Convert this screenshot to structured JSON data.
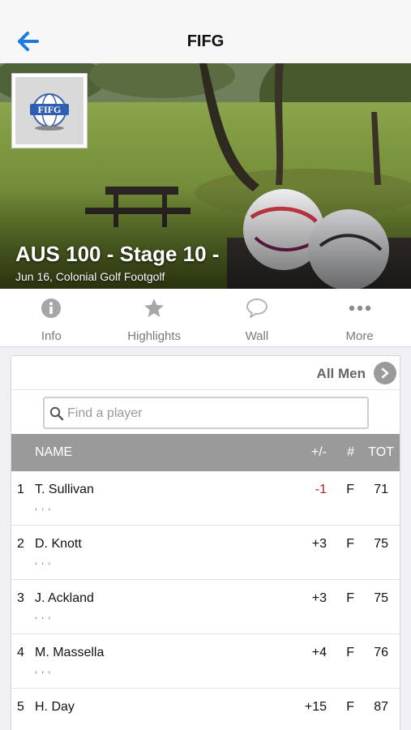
{
  "nav": {
    "title": "FIFG",
    "back_icon": "back-arrow-icon"
  },
  "event": {
    "title": "AUS 100 - Stage 10 -",
    "subtitle": "Jun 16, Colonial Golf Footgolf",
    "logo_text": "FIFG"
  },
  "tabs": [
    {
      "label": "Info",
      "icon": "info-icon"
    },
    {
      "label": "Highlights",
      "icon": "star-icon"
    },
    {
      "label": "Wall",
      "icon": "speech-bubble-icon"
    },
    {
      "label": "More",
      "icon": "more-dots-icon"
    }
  ],
  "leaderboard": {
    "filter": "All Men",
    "search_placeholder": "Find a player",
    "columns": {
      "name": "NAME",
      "diff": "+/-",
      "hole": "#",
      "total": "TOT"
    },
    "rows": [
      {
        "pos": "1",
        "name": "T. Sullivan",
        "sub": ", , ,",
        "diff": "-1",
        "hole": "F",
        "total": "71"
      },
      {
        "pos": "2",
        "name": "D. Knott",
        "sub": ", , ,",
        "diff": "+3",
        "hole": "F",
        "total": "75"
      },
      {
        "pos": "3",
        "name": "J. Ackland",
        "sub": ", , ,",
        "diff": "+3",
        "hole": "F",
        "total": "75"
      },
      {
        "pos": "4",
        "name": "M. Massella",
        "sub": ", , ,",
        "diff": "+4",
        "hole": "F",
        "total": "76"
      },
      {
        "pos": "5",
        "name": "H. Day",
        "sub": "",
        "diff": "+15",
        "hole": "F",
        "total": "87"
      }
    ]
  },
  "colors": {
    "accent": "#1a7be0",
    "negative": "#c0171a",
    "header_gray": "#9a9a9a"
  }
}
